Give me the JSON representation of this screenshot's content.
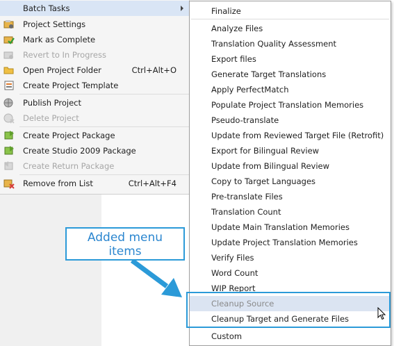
{
  "context_menu": {
    "items": [
      {
        "label": "Batch Tasks",
        "shortcut": "",
        "icon": "batch-tasks-icon",
        "disabled": false,
        "has_submenu": true
      },
      {
        "label": "Project Settings",
        "shortcut": "",
        "icon": "project-settings-icon",
        "disabled": false
      },
      {
        "label": "Mark as Complete",
        "shortcut": "",
        "icon": "mark-complete-icon",
        "disabled": false
      },
      {
        "label": "Revert to In Progress",
        "shortcut": "",
        "icon": "revert-icon",
        "disabled": true
      },
      {
        "label": "Open Project Folder",
        "shortcut": "Ctrl+Alt+O",
        "icon": "folder-icon",
        "disabled": false
      },
      {
        "label": "Create Project Template",
        "shortcut": "",
        "icon": "template-icon",
        "disabled": false
      },
      {
        "label": "Publish Project",
        "shortcut": "",
        "icon": "globe-icon",
        "disabled": false
      },
      {
        "label": "Delete Project",
        "shortcut": "",
        "icon": "globe-delete-icon",
        "disabled": true
      },
      {
        "label": "Create Project Package",
        "shortcut": "",
        "icon": "package-icon",
        "disabled": false
      },
      {
        "label": "Create Studio 2009 Package",
        "shortcut": "",
        "icon": "package-2009-icon",
        "disabled": false
      },
      {
        "label": "Create Return Package",
        "shortcut": "",
        "icon": "return-package-icon",
        "disabled": true
      },
      {
        "label": "Remove from List",
        "shortcut": "Ctrl+Alt+F4",
        "icon": "remove-icon",
        "disabled": false
      }
    ]
  },
  "submenu": {
    "items": [
      "Finalize",
      "Analyze Files",
      "Translation Quality Assessment",
      "Export files",
      "Generate Target Translations",
      "Apply PerfectMatch",
      "Populate Project Translation Memories",
      "Pseudo-translate",
      "Update from Reviewed Target File (Retrofit)",
      "Export for Bilingual Review",
      "Update from Bilingual Review",
      "Copy to Target Languages",
      "Pre-translate Files",
      "Translation Count",
      "Update Main Translation Memories",
      "Update Project Translation Memories",
      "Verify Files",
      "Word Count",
      "WIP Report",
      "Cleanup Source",
      "Cleanup Target and Generate Files",
      "Custom"
    ],
    "highlighted": "Cleanup Source"
  },
  "annotation": {
    "text_line1": "Added menu",
    "text_line2": "items",
    "color": "#2b9ad8"
  }
}
